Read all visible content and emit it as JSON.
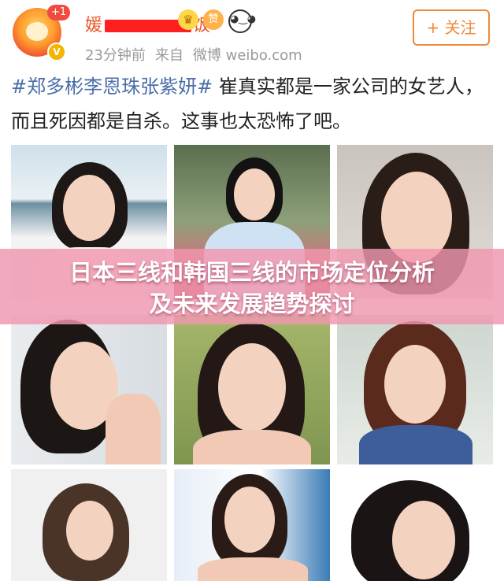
{
  "header": {
    "notification_count": "+1",
    "username_prefix": "媛",
    "username_suffix": "饭",
    "badges": [
      "crown-badge-icon",
      "zan-badge-icon",
      "panda-badge-icon"
    ],
    "zan_glyph": "赞",
    "time": "23分钟前",
    "source_prefix": "来自",
    "source": "微博 weibo.com",
    "follow_label": "+ 关注"
  },
  "post": {
    "hashtag": "#郑多彬李恩珠张紫妍#",
    "text": " 崔真实都是一家公司的女艺人，而且死因都是自杀。这事也太恐怖了吧。"
  },
  "photos": [
    {
      "name": "photo-1"
    },
    {
      "name": "photo-2"
    },
    {
      "name": "photo-3"
    },
    {
      "name": "photo-4"
    },
    {
      "name": "photo-5"
    },
    {
      "name": "photo-6"
    },
    {
      "name": "photo-7"
    },
    {
      "name": "photo-8"
    },
    {
      "name": "photo-9"
    }
  ],
  "overlay": {
    "title_line1": "日本三线和韩国三线的市场定位分析",
    "title_line2": "及未来发展趋势探讨"
  }
}
